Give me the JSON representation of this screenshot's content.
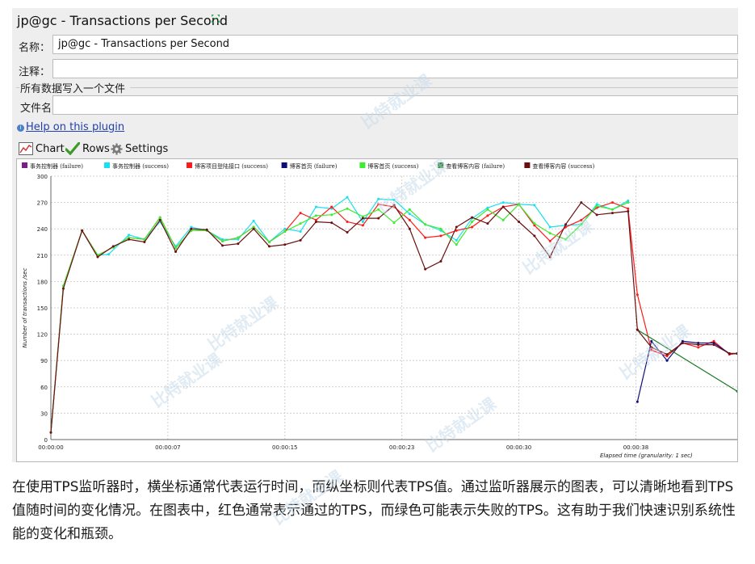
{
  "window": {
    "title": "jp@gc - Transactions per Second"
  },
  "form": {
    "name_label": "名称：",
    "name_value": "jp@gc - Transactions per Second",
    "comment_label": "注释：",
    "comment_value": "",
    "group_title": "所有数据写入一个文件",
    "filename_label": "文件名",
    "filename_value": ""
  },
  "help": {
    "link": "Help on this plugin"
  },
  "tabs": [
    {
      "label": "Chart",
      "icon": "chart-icon"
    },
    {
      "label": "Rows",
      "icon": "checkmark-icon"
    },
    {
      "label": "Settings",
      "icon": "gear-icon"
    }
  ],
  "caption": "在使用TPS监听器时，横坐标通常代表运行时间，而纵坐标则代表TPS值。通过监听器展示的图表，可以清晰地看到TPS值随时间的变化情况。在图表中，红色通常表示通过的TPS，而绿色可能表示失败的TPS。这有助于我们快速识别系统性能的变化和瓶颈。",
  "watermark": "比特就业课",
  "chart_data": {
    "type": "line",
    "ylabel": "Number of transactions /sec",
    "xlabel": "Elapsed time (granularity: 1 sec)",
    "ylim": [
      0,
      300
    ],
    "yticks": [
      0,
      30,
      60,
      90,
      120,
      150,
      180,
      210,
      240,
      270,
      300
    ],
    "xlim": [
      0,
      44
    ],
    "xticks": [
      {
        "value": 0,
        "label": "00:00:00"
      },
      {
        "value": 7.5,
        "label": "00:00:07"
      },
      {
        "value": 15,
        "label": "00:00:15"
      },
      {
        "value": 22.5,
        "label": "00:00:23"
      },
      {
        "value": 30,
        "label": "00:00:30"
      },
      {
        "value": 37.5,
        "label": "00:00:38"
      }
    ],
    "grid": true,
    "legend_position": "top",
    "series": [
      {
        "name": "事务控制器 (failure)",
        "color": "#7a1f8a",
        "values": []
      },
      {
        "name": "事务控制器 (success)",
        "color": "#19e0f0",
        "x": [
          0,
          0.8,
          2,
          3,
          3.7,
          5,
          6,
          7,
          8,
          9,
          10,
          11,
          12,
          13,
          14,
          15,
          16,
          17,
          18,
          19,
          20,
          21,
          22,
          23,
          24,
          25,
          26,
          27,
          28,
          29,
          30,
          31,
          32,
          33,
          34,
          35,
          36,
          37
        ],
        "values": [
          8,
          175,
          238,
          210,
          211,
          233,
          228,
          248,
          220,
          242,
          238,
          228,
          228,
          249,
          225,
          240,
          237,
          265,
          263,
          276,
          248,
          274,
          273,
          257,
          245,
          238,
          227,
          252,
          264,
          270,
          268,
          267,
          242,
          244,
          245,
          268,
          262,
          272
        ]
      },
      {
        "name": "博客项目登陆接口 (success)",
        "color": "#ff1a1a",
        "x": [
          0,
          0.8,
          2,
          3,
          4,
          5,
          6,
          7,
          8,
          9,
          10,
          11,
          12,
          13,
          14,
          15,
          16,
          17,
          18,
          19,
          20,
          21,
          22,
          23,
          24,
          25,
          26,
          27,
          28,
          29,
          30,
          31,
          32,
          33,
          34,
          35,
          36,
          37,
          37.6,
          38.5,
          39.5,
          40.5,
          41.5,
          42.5,
          43.5,
          44
        ],
        "values": [
          8,
          175,
          238,
          210,
          219,
          230,
          228,
          253,
          218,
          238,
          238,
          226,
          230,
          242,
          225,
          237,
          258,
          250,
          265,
          248,
          244,
          268,
          265,
          250,
          230,
          232,
          238,
          242,
          255,
          265,
          268,
          244,
          226,
          242,
          250,
          264,
          270,
          263,
          165,
          102,
          95,
          110,
          105,
          112,
          97,
          98
        ]
      },
      {
        "name": "博客首页 (failure)",
        "color": "#0d0d7a",
        "x": [
          37.6,
          38.5,
          39.5,
          40.5,
          41.5,
          42.5,
          43.5,
          44
        ],
        "values": [
          43,
          112,
          90,
          112,
          110,
          110,
          98,
          98
        ]
      },
      {
        "name": "博客首页 (success)",
        "color": "#3cee2e",
        "x": [
          0,
          0.8,
          2,
          3,
          4,
          5,
          6,
          7,
          8,
          9,
          10,
          11,
          12,
          13,
          14,
          15,
          16,
          17,
          18,
          19,
          20,
          21,
          22,
          23,
          24,
          25,
          26,
          27,
          28,
          29,
          30,
          31,
          32,
          33,
          34,
          35,
          36,
          37
        ],
        "values": [
          8,
          175,
          238,
          210,
          219,
          230,
          228,
          253,
          218,
          238,
          238,
          226,
          230,
          242,
          225,
          237,
          246,
          255,
          256,
          263,
          254,
          262,
          247,
          262,
          245,
          240,
          222,
          248,
          262,
          250,
          268,
          246,
          235,
          228,
          245,
          266,
          262,
          270
        ]
      },
      {
        "name": "查看博客内容 (failure)",
        "color": "#17781f",
        "x": [
          37.6,
          44
        ],
        "values": [
          125,
          55
        ]
      },
      {
        "name": "查看博客内容 (success)",
        "color": "#6b1010",
        "x": [
          0,
          0.8,
          2,
          3,
          4,
          5,
          6,
          7,
          8,
          9,
          10,
          11,
          12,
          13,
          14,
          15,
          16,
          17,
          18,
          19,
          20,
          21,
          22,
          23,
          24,
          25,
          26,
          27,
          28,
          29,
          30,
          31,
          32,
          33,
          34,
          35,
          36,
          37,
          37.6,
          38.5,
          39.5,
          40.5,
          41.5,
          42.5,
          43.5,
          44
        ],
        "values": [
          8,
          172,
          238,
          208,
          220,
          228,
          225,
          250,
          214,
          240,
          239,
          221,
          223,
          240,
          220,
          222,
          227,
          248,
          247,
          236,
          252,
          252,
          267,
          240,
          194,
          203,
          242,
          253,
          246,
          265,
          248,
          232,
          208,
          245,
          270,
          256,
          258,
          260,
          125,
          105,
          97,
          110,
          108,
          108,
          98,
          98
        ]
      }
    ]
  }
}
